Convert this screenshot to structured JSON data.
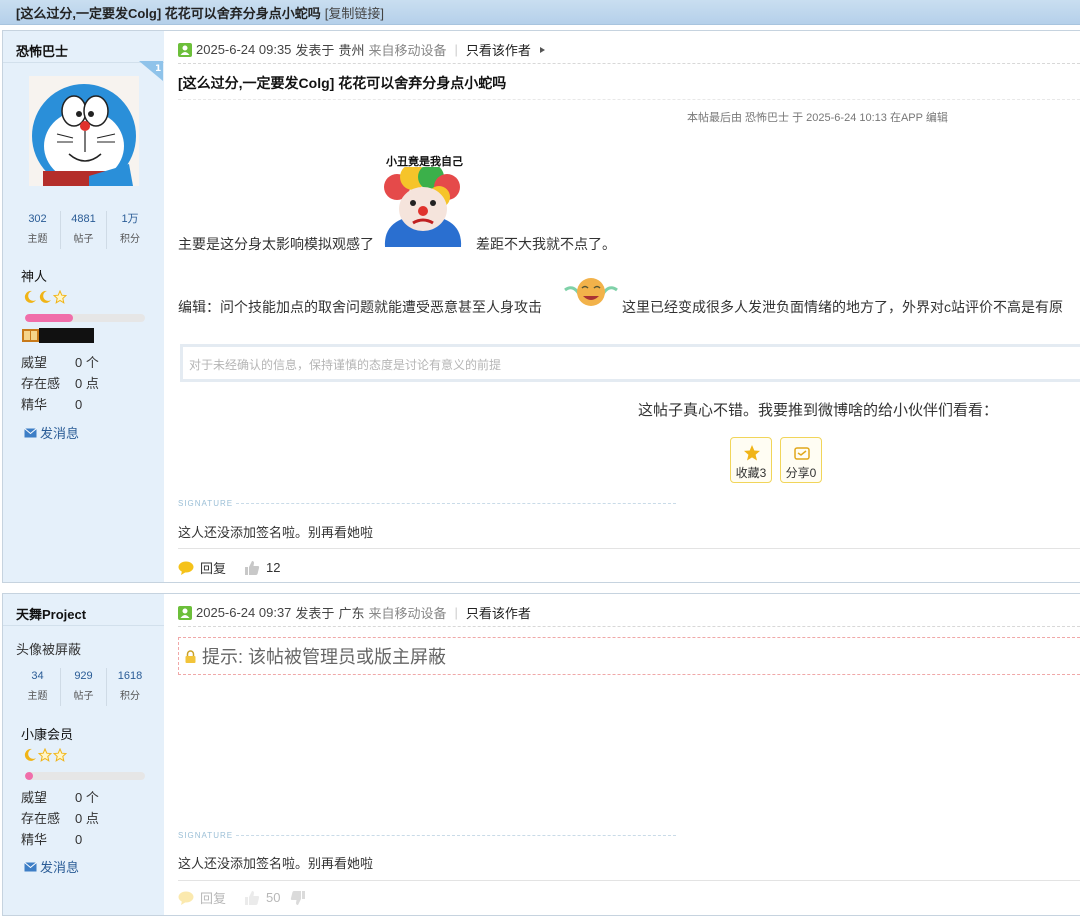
{
  "thread": {
    "title": "[这么过分,一定要发Colg] 花花可以舍弃分身点小蛇吗",
    "copy_link": "[复制链接]"
  },
  "colors": {
    "accent_blue": "#2a5c96",
    "sidebar_bg": "#e5f0fa",
    "exp_pink": "#f06eaa"
  },
  "posts": [
    {
      "author": {
        "name": "恐怖巴士",
        "avatar": "doraemon-avatar",
        "stats": [
          {
            "value": "302",
            "label": "主题"
          },
          {
            "value": "4881",
            "label": "帖子"
          },
          {
            "value": "1万",
            "label": "积分"
          }
        ],
        "rank": "神人",
        "exp_fraction": 0.4,
        "info": [
          {
            "key": "威望",
            "val": "0 个"
          },
          {
            "key": "存在感",
            "val": "0 点"
          },
          {
            "key": "精华",
            "val": "0"
          }
        ],
        "send_msg": "发消息"
      },
      "meta": {
        "date": "2025-6-24 09:35",
        "posted_in": "发表于",
        "location": "贵州",
        "device": "来自移动设备",
        "only_author": "只看该作者"
      },
      "title": "[这么过分,一定要发Colg] 花花可以舍弃分身点小蛇吗",
      "edit_note": "本帖最后由 恐怖巴士 于 2025-6-24 10:13 在APP 编辑",
      "sticker1_caption": "小丑竟是我自己",
      "body1_a": "主要是这分身太影响模拟观感了",
      "body1_b": "差距不大我就不点了。",
      "body2_a": "编辑：问个技能加点的取舍问题就能遭受恶意甚至人身攻击",
      "body2_b": "这里已经变成很多人发泄负面情绪的地方了，外界对c站评价不高是有原",
      "quote": "对于未经确认的信息，保持谨慎的态度是讨论有意义的前提",
      "share_text": "这帖子真心不错。我要推到微博啥的给小伙伴们看看：",
      "fav_label": "收藏3",
      "share_label": "分享0",
      "signature_head": "SIGNATURE",
      "signature": "这人还没添加签名啦。别再看她啦",
      "reply_label": "回复",
      "like_count": "12"
    },
    {
      "author": {
        "name": "天舞Project",
        "avatar_hidden": "头像被屏蔽",
        "stats": [
          {
            "value": "34",
            "label": "主题"
          },
          {
            "value": "929",
            "label": "帖子"
          },
          {
            "value": "1618",
            "label": "积分"
          }
        ],
        "rank": "小康会员",
        "exp_fraction": 0.07,
        "info": [
          {
            "key": "威望",
            "val": "0 个"
          },
          {
            "key": "存在感",
            "val": "0 点"
          },
          {
            "key": "精华",
            "val": "0"
          }
        ],
        "send_msg": "发消息"
      },
      "meta": {
        "date": "2025-6-24 09:37",
        "posted_in": "发表于",
        "location": "广东",
        "device": "来自移动设备",
        "only_author": "只看该作者"
      },
      "notice": "提示: 该帖被管理员或版主屏蔽",
      "signature_head": "SIGNATURE",
      "signature": "这人还没添加签名啦。别再看她啦",
      "reply_label": "回复",
      "like_count": "50"
    }
  ]
}
